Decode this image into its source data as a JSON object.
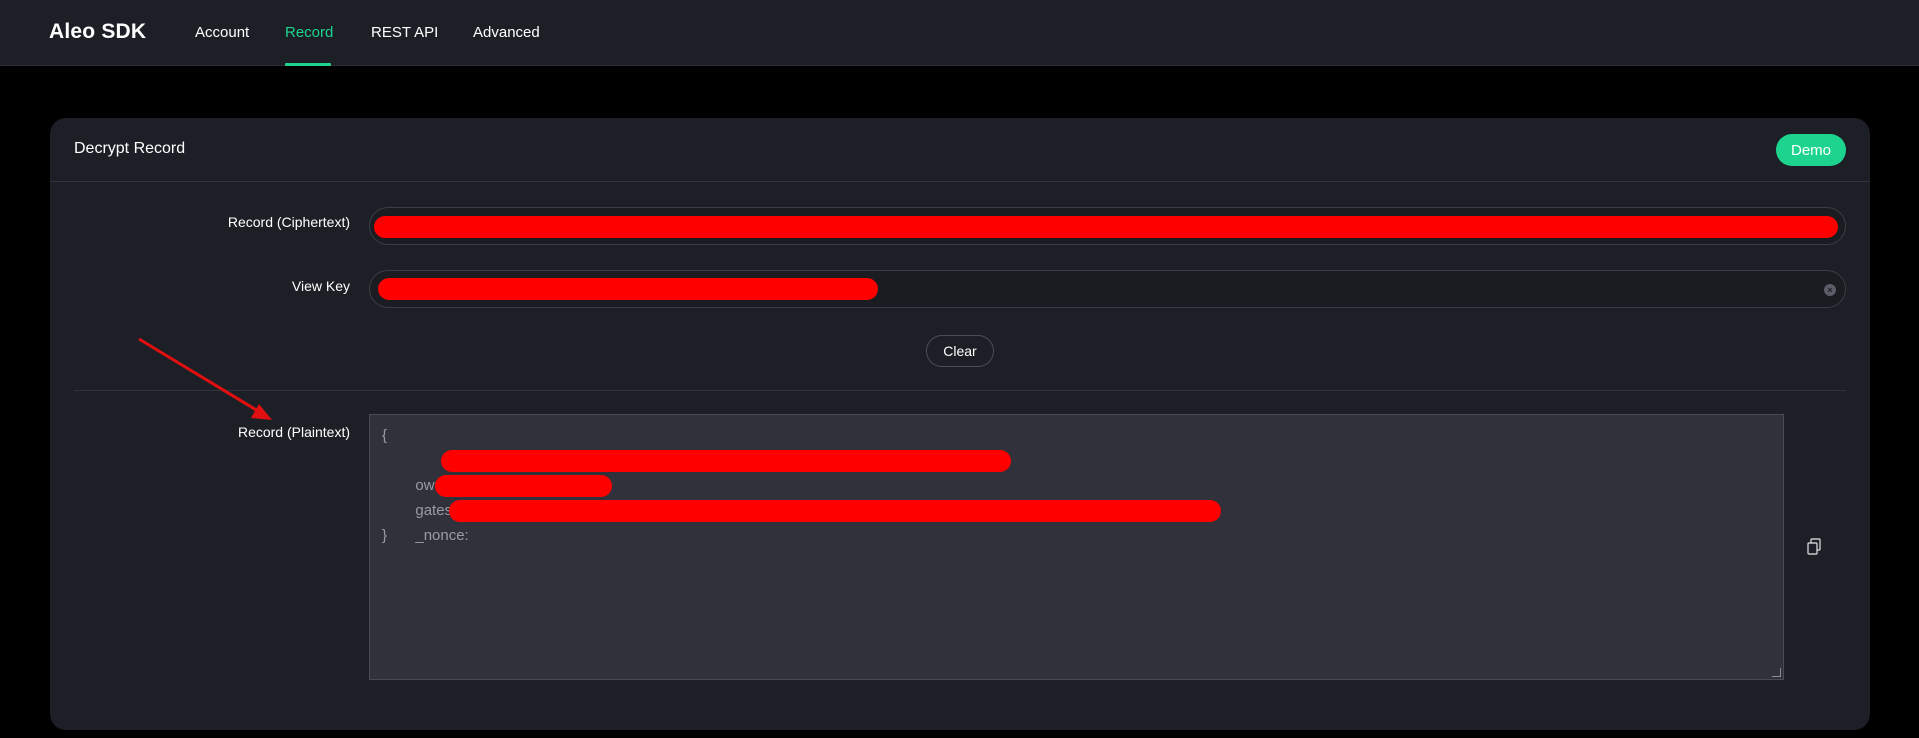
{
  "header": {
    "brand": "Aleo SDK",
    "nav": [
      {
        "label": "Account"
      },
      {
        "label": "Record"
      },
      {
        "label": "REST API"
      },
      {
        "label": "Advanced"
      }
    ],
    "active_tab": "Record",
    "accent_color": "#1dd48f"
  },
  "card": {
    "title": "Decrypt Record",
    "demo_label": "Demo",
    "ciphertext_label": "Record (Ciphertext)",
    "viewkey_label": "View Key",
    "clear_label": "Clear",
    "plaintext_label": "Record (Plaintext)",
    "plaintext_lines": {
      "open": "{",
      "owner": "  owner:",
      "gates": "  gates:",
      "nonce": "  _nonce:",
      "close": "}"
    },
    "redaction_color": "#ff0000"
  },
  "icons": {
    "input_clear": "circle-x-icon",
    "copy": "copy-icon",
    "annotation": "red-arrow"
  }
}
